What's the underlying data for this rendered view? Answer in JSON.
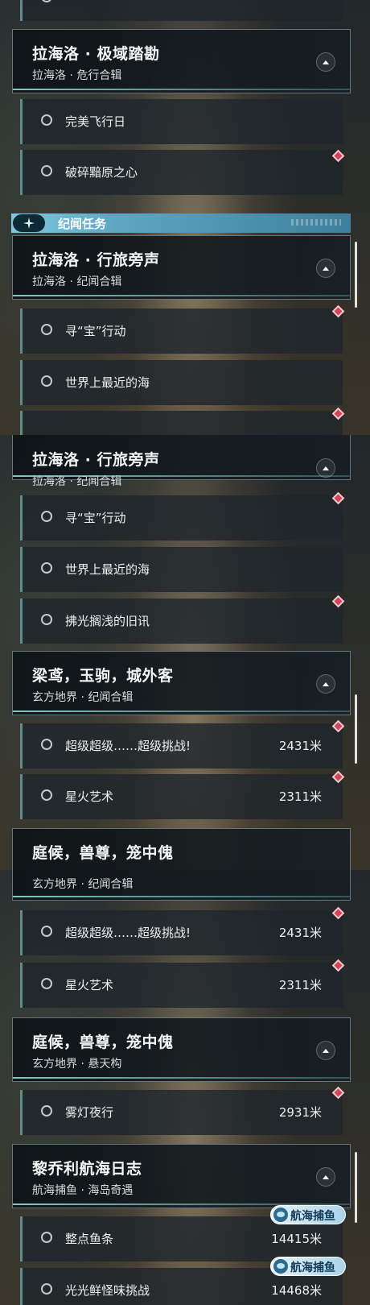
{
  "accent_color": "#7fc9df",
  "marker_color": "#d94254",
  "icons": {
    "collapse": "chevron-up-icon",
    "section": "four-point-star-icon",
    "marker": "diamond-marker-icon",
    "tag": "fish-icon"
  },
  "panel1": {
    "group_labyrinth": {
      "title": "拉海洛 · 极域踏勘",
      "subtitle": "拉海洛 · 危行合辑",
      "items": [
        "完美飞行日",
        "破碎黯原之心"
      ]
    },
    "section_label": "纪闻任务",
    "group_travel": {
      "title": "拉海洛 · 行旅旁声",
      "subtitle": "拉海洛 · 纪闻合辑",
      "items": [
        "寻“宝”行动",
        "世界上最近的海"
      ]
    }
  },
  "panel2": {
    "group_travel": {
      "title": "拉海洛 · 行旅旁声",
      "subtitle": "拉海洛 · 纪闻合辑",
      "items": [
        "寻“宝”行动",
        "世界上最近的海",
        "拂光搁浅的旧讯"
      ]
    },
    "group_liang": {
      "title": "梁鸢，玉驹，城外客",
      "subtitle": "玄方地界 · 纪闻合辑",
      "items": [
        {
          "name": "超级超级……超级挑战!",
          "distance": "2431米"
        },
        {
          "name": "星火艺术",
          "distance": "2311米"
        }
      ]
    },
    "group_next_partial_title": "庭候，兽尊，笼中傀"
  },
  "panel3": {
    "group_liang": {
      "subtitle": "玄方地界 · 纪闻合辑",
      "items": [
        {
          "name": "超级超级……超级挑战!",
          "distance": "2431米"
        },
        {
          "name": "星火艺术",
          "distance": "2311米"
        }
      ]
    },
    "group_ting": {
      "title": "庭候，兽尊，笼中傀",
      "subtitle": "玄方地界 · 悬天构",
      "items": [
        {
          "name": "雾灯夜行",
          "distance": "2931米"
        }
      ]
    },
    "group_fish": {
      "title": "黎乔利航海日志",
      "subtitle": "航海捕鱼 · 海岛奇遇",
      "items": [
        {
          "name": "整点鱼条",
          "distance": "14415米",
          "tag": "航海捕鱼"
        },
        {
          "name": "光光鲜怪味挑战",
          "distance": "14468米",
          "tag": "航海捕鱼"
        }
      ]
    }
  }
}
